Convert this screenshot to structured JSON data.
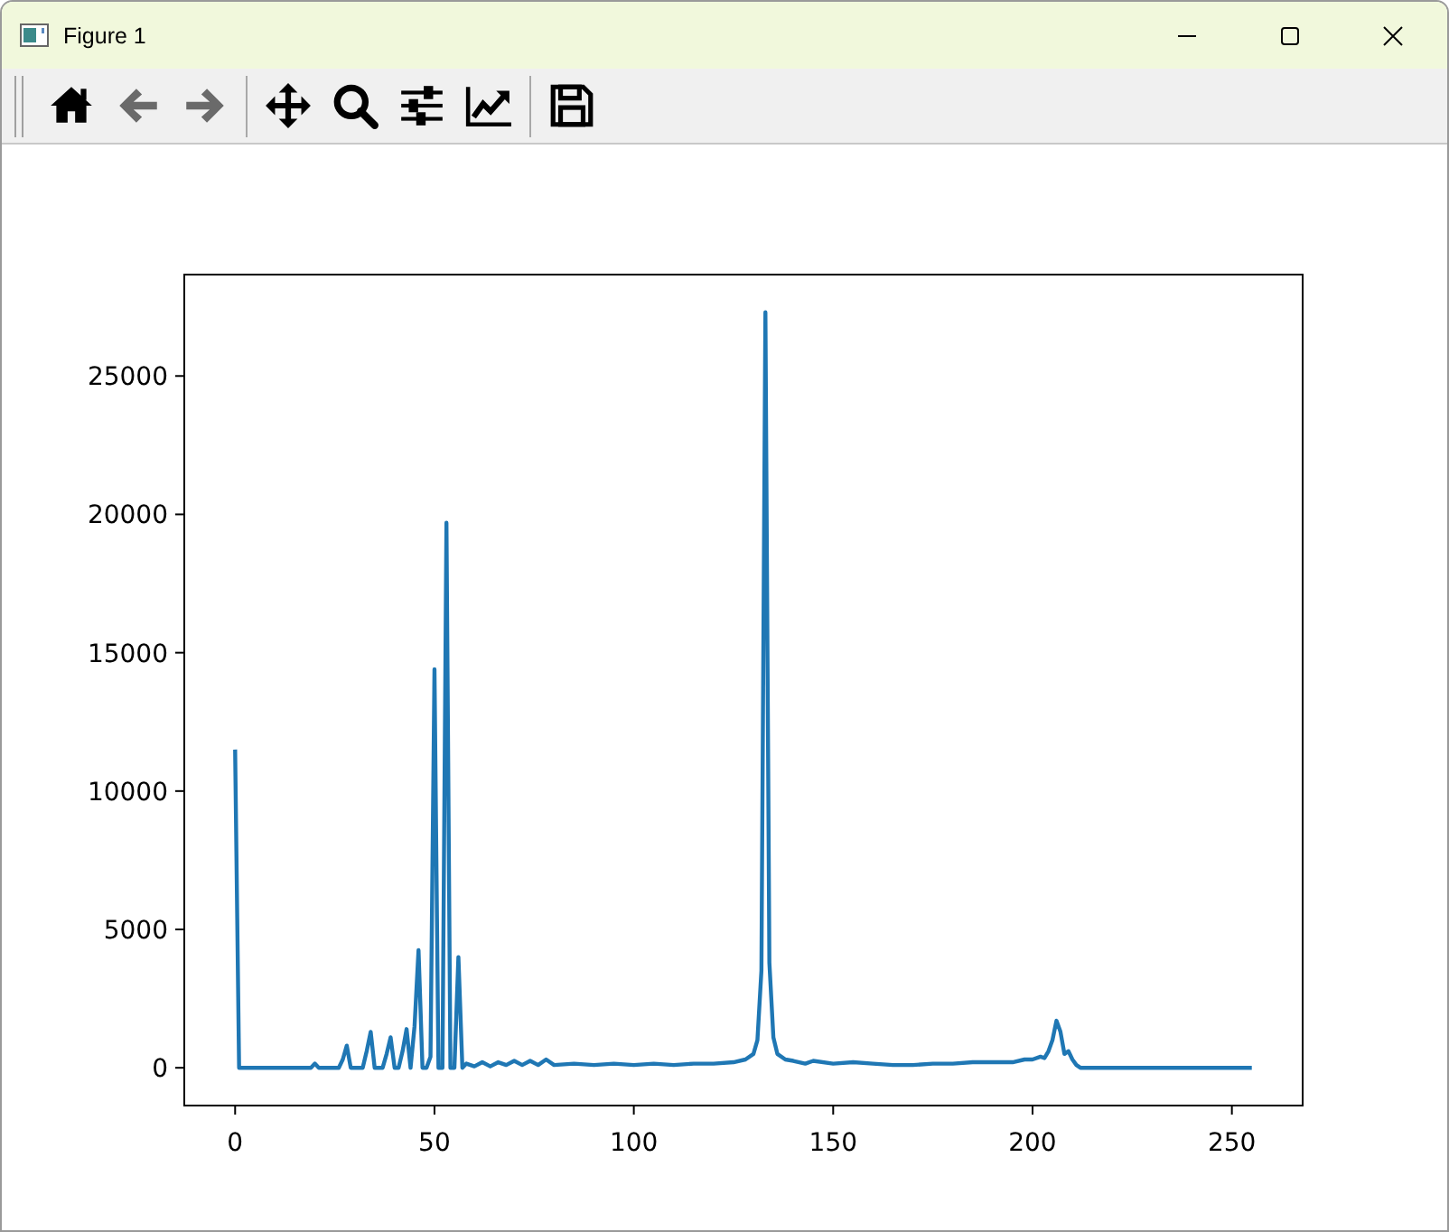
{
  "window": {
    "title": "Figure 1"
  },
  "toolbar": {
    "tools": [
      {
        "kind": "home",
        "disabled": false
      },
      {
        "kind": "back",
        "disabled": true
      },
      {
        "kind": "forward",
        "disabled": true
      },
      {
        "kind": "separator"
      },
      {
        "kind": "pan",
        "disabled": false
      },
      {
        "kind": "zoom",
        "disabled": false
      },
      {
        "kind": "subplots",
        "disabled": false
      },
      {
        "kind": "lines",
        "disabled": false
      },
      {
        "kind": "separator"
      },
      {
        "kind": "save",
        "disabled": false
      }
    ]
  },
  "figure": {
    "chart_data": {
      "type": "line",
      "xlim": [
        -12.75,
        267.75
      ],
      "ylim": [
        -1365,
        28665
      ],
      "xticks": [
        0,
        50,
        100,
        150,
        200,
        250
      ],
      "yticks": [
        0,
        5000,
        10000,
        15000,
        20000,
        25000
      ],
      "x": [
        0,
        1,
        19,
        20,
        21,
        26,
        27,
        28,
        29,
        32,
        33,
        34,
        35,
        37,
        38,
        39,
        40,
        41,
        42,
        43,
        44,
        45,
        46,
        47,
        48,
        49,
        50,
        51,
        52,
        53,
        54,
        55,
        56,
        57,
        58,
        60,
        62,
        64,
        66,
        68,
        70,
        72,
        74,
        76,
        78,
        80,
        85,
        90,
        95,
        100,
        105,
        110,
        115,
        120,
        125,
        128,
        130,
        131,
        132,
        133,
        134,
        135,
        136,
        138,
        140,
        143,
        145,
        150,
        155,
        160,
        165,
        170,
        175,
        180,
        185,
        190,
        195,
        198,
        200,
        202,
        203,
        204,
        205,
        206,
        207,
        208,
        209,
        210,
        211,
        212,
        220,
        230,
        240,
        255
      ],
      "series": [
        {
          "color": "#1f77b4",
          "values": [
            11500,
            0,
            0,
            150,
            0,
            0,
            300,
            800,
            0,
            0,
            600,
            1300,
            0,
            0,
            500,
            1100,
            0,
            0,
            600,
            1400,
            0,
            1500,
            4250,
            0,
            0,
            400,
            14400,
            0,
            0,
            19700,
            0,
            0,
            4000,
            0,
            150,
            50,
            200,
            50,
            200,
            100,
            250,
            100,
            250,
            100,
            300,
            100,
            150,
            100,
            150,
            100,
            150,
            100,
            150,
            150,
            200,
            300,
            500,
            1000,
            3500,
            27300,
            3800,
            1100,
            500,
            300,
            250,
            150,
            250,
            150,
            200,
            150,
            100,
            100,
            150,
            150,
            200,
            200,
            200,
            300,
            300,
            400,
            350,
            600,
            1000,
            1700,
            1300,
            500,
            600,
            300,
            100,
            0,
            0,
            0,
            0,
            0
          ]
        }
      ]
    }
  }
}
